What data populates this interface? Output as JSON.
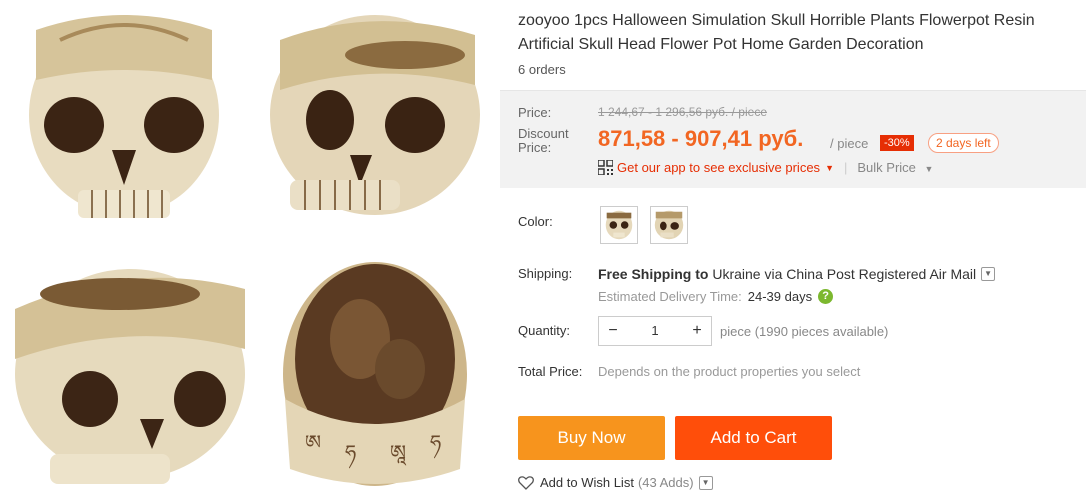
{
  "product": {
    "title": "zooyoo 1pcs Halloween Simulation Skull Horrible Plants Flowerpot Resin Artificial Skull Head Flower Pot Home Garden Decoration",
    "orders": "6 orders"
  },
  "pricing": {
    "price_label": "Price:",
    "original_price": "1 244,67 - 1 296,56 руб. / piece",
    "discount_label": "Discount Price:",
    "discount_price": "871,58 - 907,41 руб.",
    "per_piece": "/ piece",
    "discount_badge": "-30%",
    "days_left": "2 days left",
    "app_promo": "Get our app to see exclusive prices",
    "bulk_price": "Bulk Price"
  },
  "color": {
    "label": "Color:",
    "options": [
      "skull-front",
      "skull-side"
    ]
  },
  "shipping": {
    "label": "Shipping:",
    "free_shipping": "Free Shipping",
    "to_text": "to",
    "country": "Ukraine",
    "via_text": "via China Post Registered Air Mail",
    "edt_label": "Estimated Delivery Time:",
    "edt_days": "24-39 days"
  },
  "quantity": {
    "label": "Quantity:",
    "value": "1",
    "minus": "−",
    "plus": "+",
    "availability": "piece (1990 pieces available)"
  },
  "total": {
    "label": "Total Price:",
    "value": "Depends on the product properties you select"
  },
  "actions": {
    "buy_now": "Buy Now",
    "add_to_cart": "Add to Cart",
    "wishlist": "Add to Wish List",
    "wishlist_count": "(43 Adds)"
  },
  "colors": {
    "accent_orange": "#f26622",
    "buy_now_bg": "#f7941d",
    "add_to_cart_bg": "#ff4e0a",
    "discount_badge_bg": "#e62e04"
  }
}
